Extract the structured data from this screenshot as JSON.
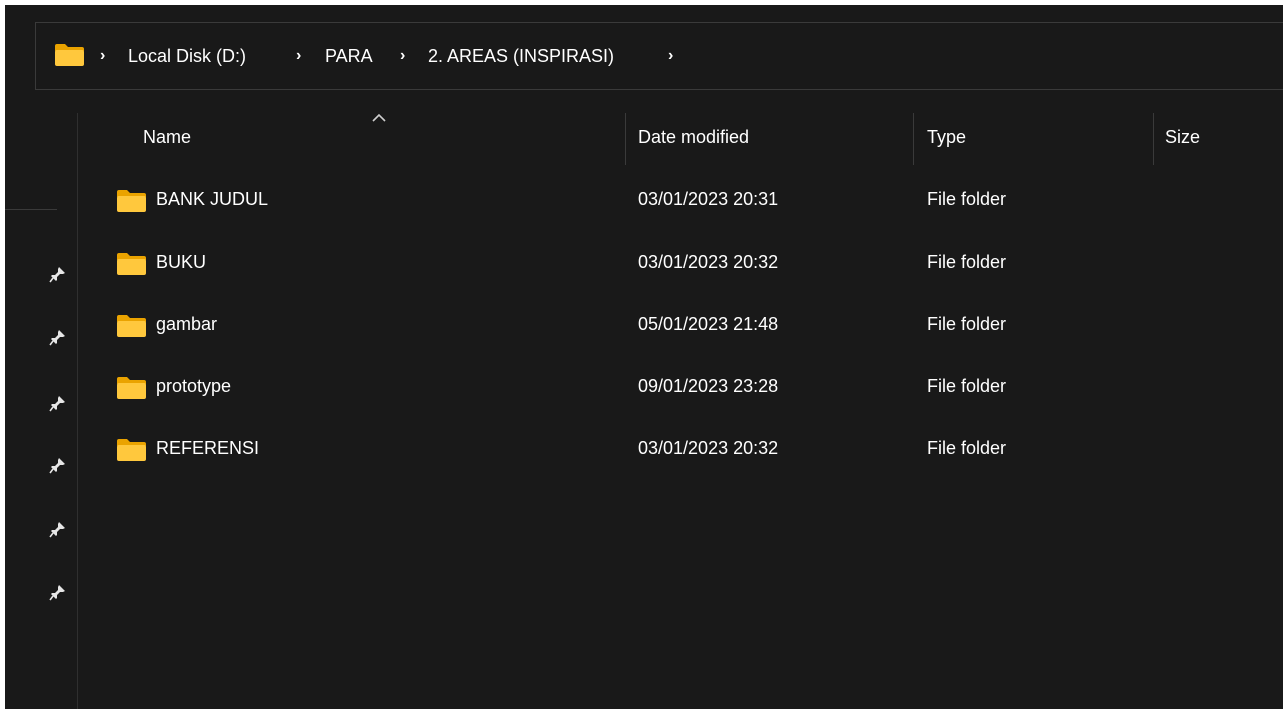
{
  "address_bar": {
    "crumbs": [
      "Local Disk (D:)",
      "PARA",
      "2. AREAS (INSPIRASI)"
    ],
    "separator": "›"
  },
  "columns": {
    "name": "Name",
    "date_modified": "Date modified",
    "type": "Type",
    "size": "Size"
  },
  "sort": {
    "column": "name",
    "direction": "ascending",
    "icon": "chevron-up-icon"
  },
  "files": [
    {
      "name": "BANK JUDUL",
      "date_modified": "03/01/2023 20:31",
      "type": "File folder",
      "size": ""
    },
    {
      "name": "BUKU",
      "date_modified": "03/01/2023 20:32",
      "type": "File folder",
      "size": ""
    },
    {
      "name": "gambar",
      "date_modified": "05/01/2023 21:48",
      "type": "File folder",
      "size": ""
    },
    {
      "name": "prototype",
      "date_modified": "09/01/2023 23:28",
      "type": "File folder",
      "size": ""
    },
    {
      "name": "REFERENSI",
      "date_modified": "03/01/2023 20:32",
      "type": "File folder",
      "size": ""
    }
  ],
  "quick_access_pins": 6,
  "colors": {
    "background": "#191919",
    "text": "#ffffff",
    "folder_icon": "#ffc83d",
    "folder_tab": "#eaa300",
    "divider": "#3a3a3a"
  }
}
